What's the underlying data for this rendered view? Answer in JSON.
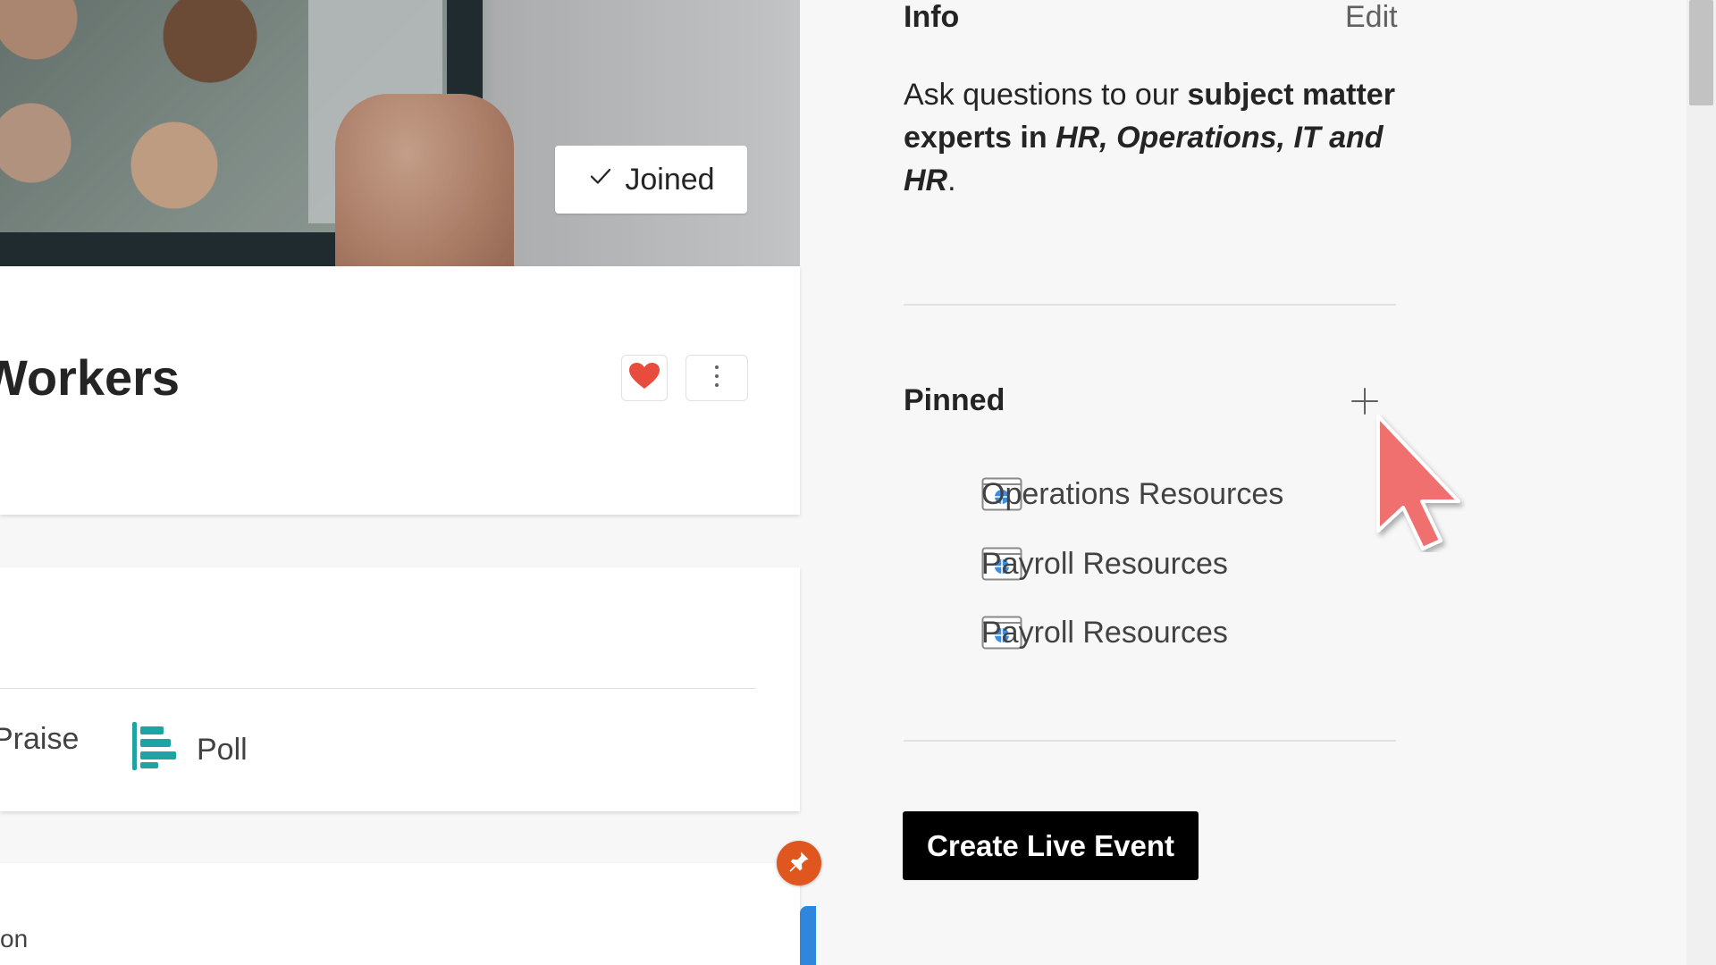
{
  "left_column": {
    "joined_label": "Joined",
    "group_name": "Workers",
    "compose_actions": {
      "praise_label": "Praise",
      "poll_label": "Poll"
    },
    "post_snippet": "on"
  },
  "info": {
    "heading": "Info",
    "edit_label": "Edit",
    "text_plain": "Ask questions to our ",
    "text_bold": "subject matter experts in ",
    "text_bold_italic": "HR, Operations, IT and HR",
    "text_end": "."
  },
  "pinned": {
    "heading": "Pinned",
    "items": [
      {
        "label": "Operations Resources",
        "icon": "web-link-icon"
      },
      {
        "label": "Payroll Resources",
        "icon": "web-link-icon"
      },
      {
        "label": "Payroll Resources",
        "icon": "web-link-icon"
      }
    ]
  },
  "actions": {
    "create_live_event": "Create Live Event"
  },
  "colors": {
    "accent_teal": "#1fa3a3",
    "heart_red": "#e74c3c",
    "pin_orange": "#e0561f",
    "cursor_red": "#f07070"
  }
}
